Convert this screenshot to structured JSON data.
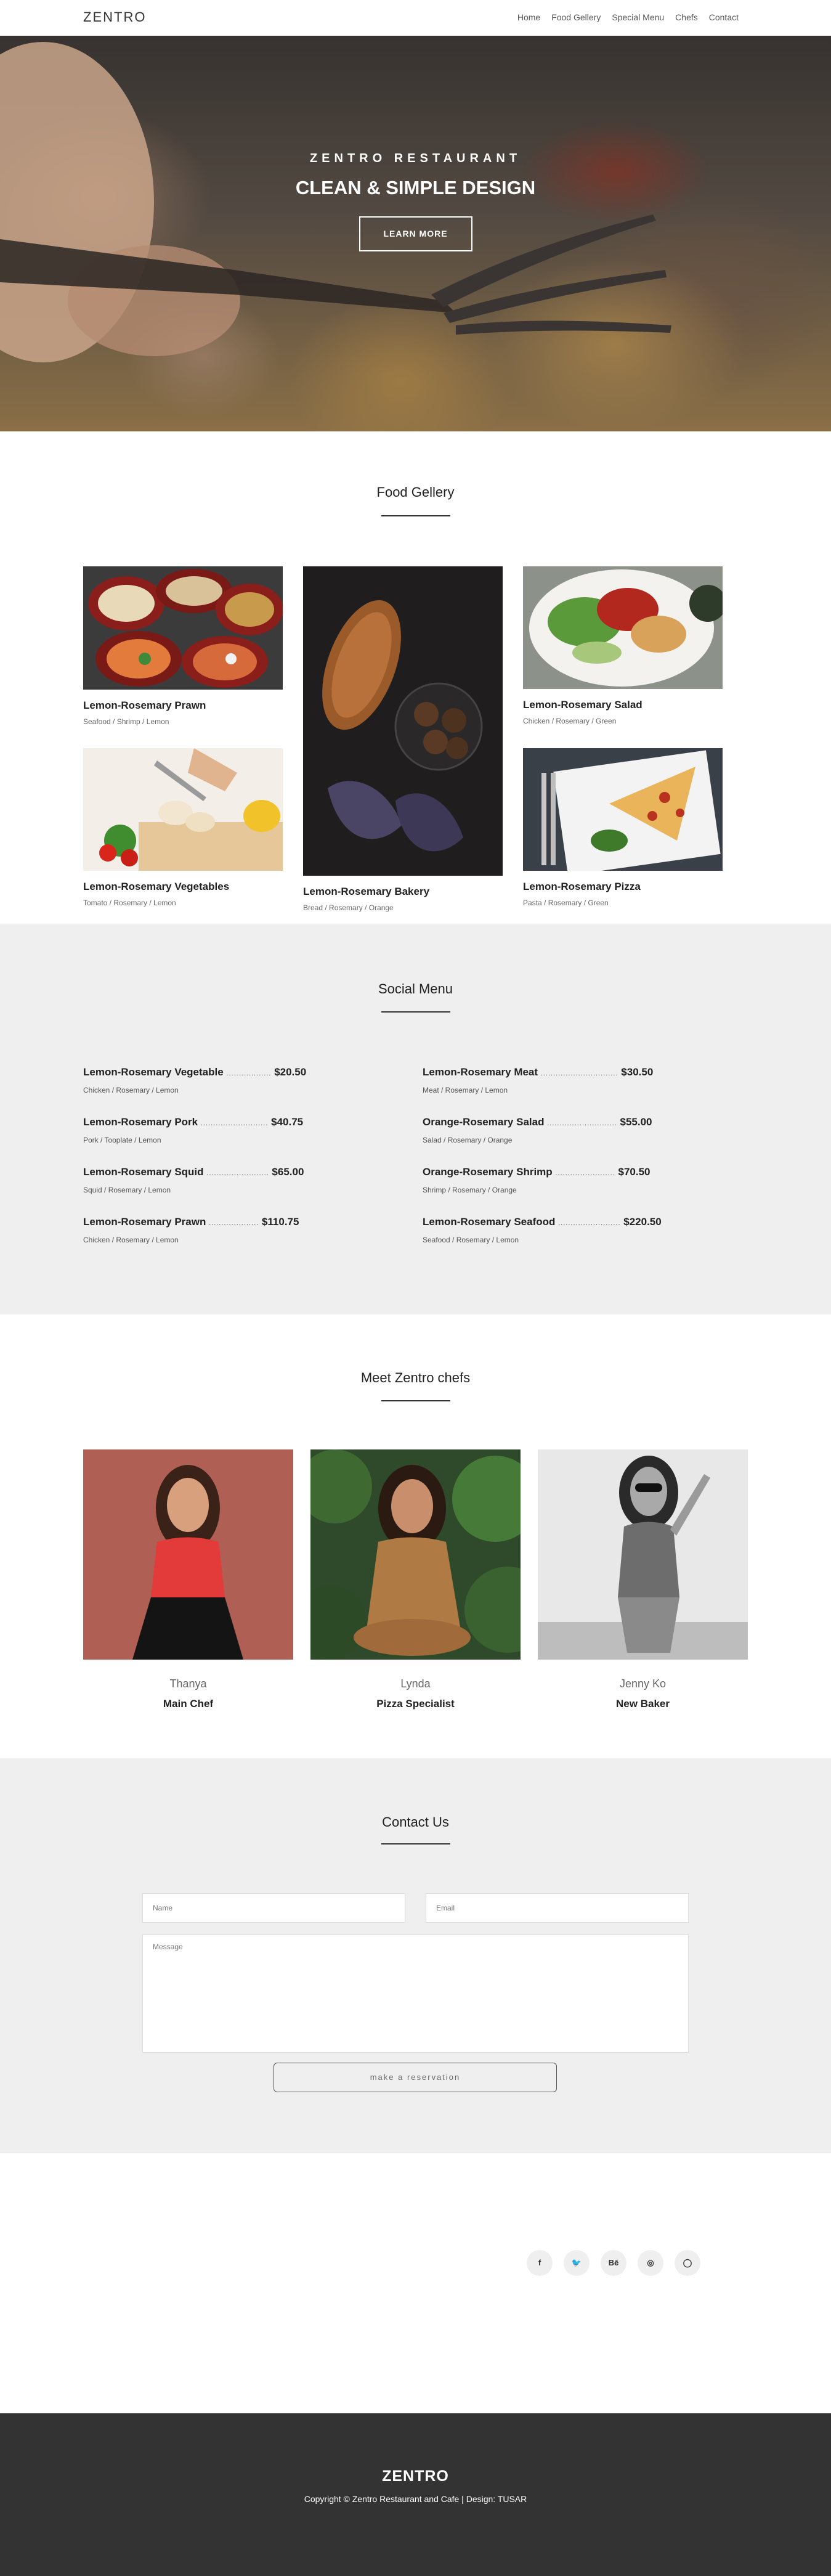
{
  "nav": {
    "brand": "ZENTRO",
    "links": [
      "Home",
      "Food Gellery",
      "Special Menu",
      "Chefs",
      "Contact"
    ]
  },
  "hero": {
    "kicker": "ZENTRO RESTAURANT",
    "title": "CLEAN & SIMPLE DESIGN",
    "button": "LEARN MORE"
  },
  "gallery": {
    "title": "Food Gellery",
    "items": [
      {
        "name": "Lemon-Rosemary Prawn",
        "tags": "Seafood / Shrimp / Lemon"
      },
      {
        "name": "Lemon-Rosemary Vegetables",
        "tags": "Tomato / Rosemary / Lemon"
      },
      {
        "name": "Lemon-Rosemary Bakery",
        "tags": "Bread / Rosemary / Orange"
      },
      {
        "name": "Lemon-Rosemary Salad",
        "tags": "Chicken / Rosemary / Green"
      },
      {
        "name": "Lemon-Rosemary Pizza",
        "tags": "Pasta / Rosemary / Green"
      }
    ]
  },
  "menu": {
    "title": "Social Menu",
    "items": [
      {
        "name": "Lemon-Rosemary Vegetable",
        "dots": "..................",
        "price": "$20.50",
        "desc": "Chicken / Rosemary / Lemon"
      },
      {
        "name": "Lemon-Rosemary Pork",
        "dots": "...........................",
        "price": "$40.75",
        "desc": "Pork / Tooplate / Lemon"
      },
      {
        "name": "Lemon-Rosemary Squid",
        "dots": ".........................",
        "price": "$65.00",
        "desc": "Squid / Rosemary / Lemon"
      },
      {
        "name": "Lemon-Rosemary Prawn",
        "dots": "....................",
        "price": "$110.75",
        "desc": "Chicken / Rosemary / Lemon"
      },
      {
        "name": "Lemon-Rosemary Meat",
        "dots": "...............................",
        "price": "$30.50",
        "desc": "Meat / Rosemary / Lemon"
      },
      {
        "name": "Orange-Rosemary Salad",
        "dots": "............................",
        "price": "$55.00",
        "desc": "Salad / Rosemary / Orange"
      },
      {
        "name": "Orange-Rosemary Shrimp",
        "dots": "........................",
        "price": "$70.50",
        "desc": "Shrimp / Rosemary / Orange"
      },
      {
        "name": "Lemon-Rosemary Seafood",
        "dots": ".........................",
        "price": "$220.50",
        "desc": "Seafood / Rosemary / Lemon"
      }
    ]
  },
  "chefs": {
    "title": "Meet Zentro chefs",
    "items": [
      {
        "name": "Thanya",
        "role": "Main Chef"
      },
      {
        "name": "Lynda",
        "role": "Pizza Specialist"
      },
      {
        "name": "Jenny Ko",
        "role": "New Baker"
      }
    ]
  },
  "contact": {
    "title": "Contact Us",
    "name_placeholder": "Name",
    "email_placeholder": "Email",
    "message_placeholder": "Message",
    "button": "make a reservation"
  },
  "social": {
    "icons": [
      "facebook-icon",
      "twitter-icon",
      "behance-icon",
      "dribbble-icon",
      "github-icon"
    ],
    "glyphs": [
      "f",
      "🐦",
      "Bē",
      "◎",
      "◯"
    ]
  },
  "footer": {
    "brand": "ZENTRO",
    "copyright": "Copyright © Zentro Restaurant and Cafe | Design: TUSAR"
  }
}
